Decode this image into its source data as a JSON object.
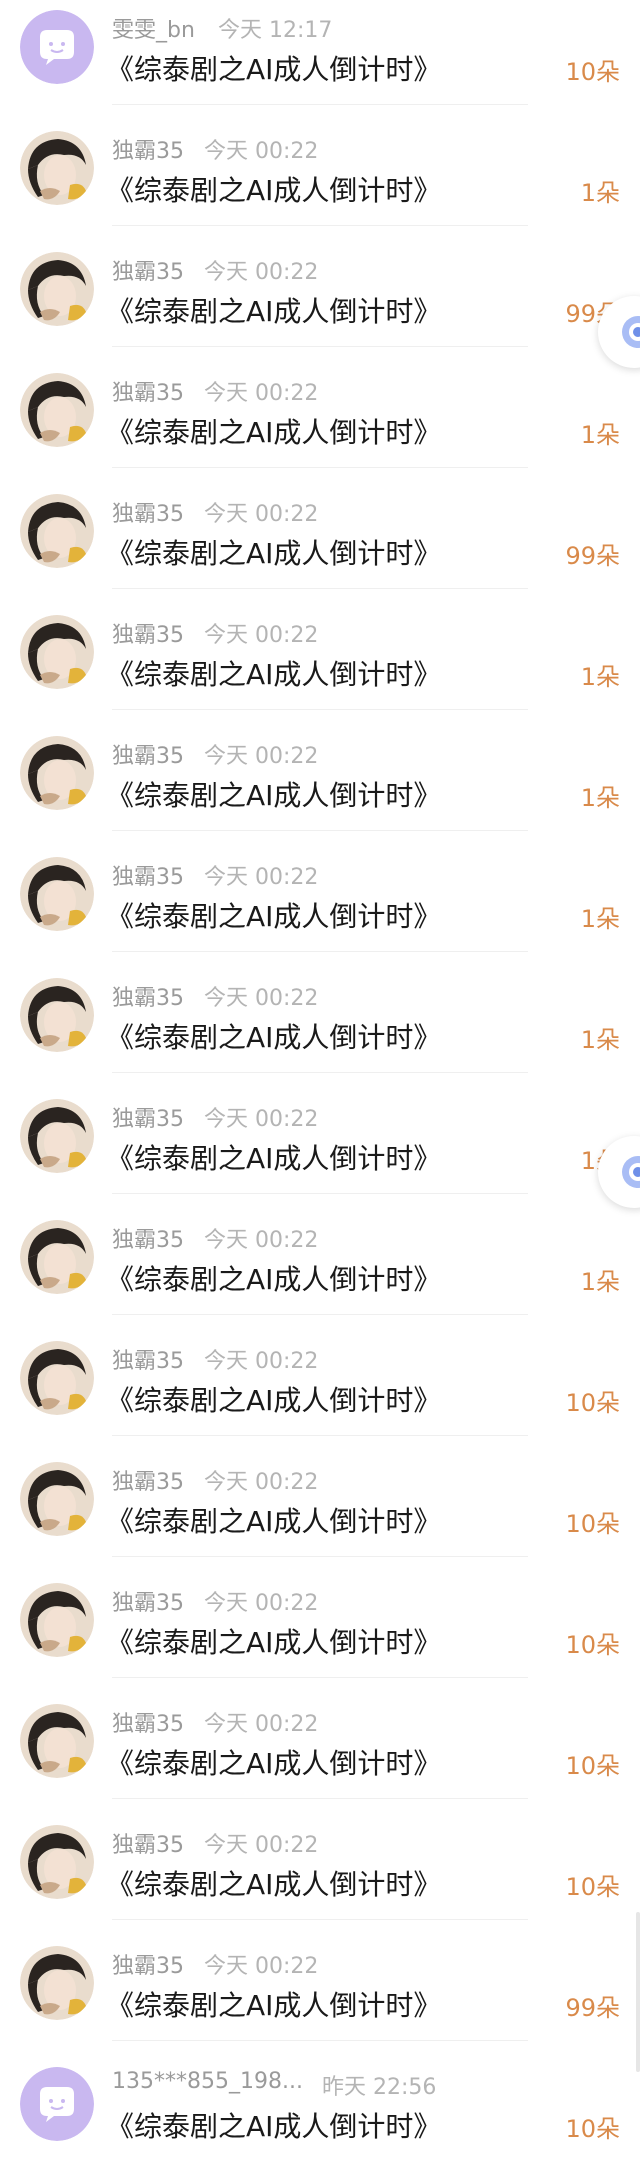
{
  "colors": {
    "gift_text": "#d98a4a",
    "title_text": "#1a1a1a",
    "name_text": "#9a9a9a",
    "time_text": "#b4b4b4",
    "lavender_avatar": "#c9b8f0"
  },
  "rows": [
    {
      "avatar": "speech-bubble-icon",
      "name": "雯雯_bn",
      "time": "今天 12:17",
      "title": "《综泰剧之AI成人倒计时》",
      "gift": "10朵"
    },
    {
      "avatar": "user-photo",
      "name": "独霸35",
      "time": "今天 00:22",
      "title": "《综泰剧之AI成人倒计时》",
      "gift": "1朵"
    },
    {
      "avatar": "user-photo",
      "name": "独霸35",
      "time": "今天 00:22",
      "title": "《综泰剧之AI成人倒计时》",
      "gift": "99朵"
    },
    {
      "avatar": "user-photo",
      "name": "独霸35",
      "time": "今天 00:22",
      "title": "《综泰剧之AI成人倒计时》",
      "gift": "1朵"
    },
    {
      "avatar": "user-photo",
      "name": "独霸35",
      "time": "今天 00:22",
      "title": "《综泰剧之AI成人倒计时》",
      "gift": "99朵"
    },
    {
      "avatar": "user-photo",
      "name": "独霸35",
      "time": "今天 00:22",
      "title": "《综泰剧之AI成人倒计时》",
      "gift": "1朵"
    },
    {
      "avatar": "user-photo",
      "name": "独霸35",
      "time": "今天 00:22",
      "title": "《综泰剧之AI成人倒计时》",
      "gift": "1朵"
    },
    {
      "avatar": "user-photo",
      "name": "独霸35",
      "time": "今天 00:22",
      "title": "《综泰剧之AI成人倒计时》",
      "gift": "1朵"
    },
    {
      "avatar": "user-photo",
      "name": "独霸35",
      "time": "今天 00:22",
      "title": "《综泰剧之AI成人倒计时》",
      "gift": "1朵"
    },
    {
      "avatar": "user-photo",
      "name": "独霸35",
      "time": "今天 00:22",
      "title": "《综泰剧之AI成人倒计时》",
      "gift": "1朵"
    },
    {
      "avatar": "user-photo",
      "name": "独霸35",
      "time": "今天 00:22",
      "title": "《综泰剧之AI成人倒计时》",
      "gift": "1朵"
    },
    {
      "avatar": "user-photo",
      "name": "独霸35",
      "time": "今天 00:22",
      "title": "《综泰剧之AI成人倒计时》",
      "gift": "10朵"
    },
    {
      "avatar": "user-photo",
      "name": "独霸35",
      "time": "今天 00:22",
      "title": "《综泰剧之AI成人倒计时》",
      "gift": "10朵"
    },
    {
      "avatar": "user-photo",
      "name": "独霸35",
      "time": "今天 00:22",
      "title": "《综泰剧之AI成人倒计时》",
      "gift": "10朵"
    },
    {
      "avatar": "user-photo",
      "name": "独霸35",
      "time": "今天 00:22",
      "title": "《综泰剧之AI成人倒计时》",
      "gift": "10朵"
    },
    {
      "avatar": "user-photo",
      "name": "独霸35",
      "time": "今天 00:22",
      "title": "《综泰剧之AI成人倒计时》",
      "gift": "10朵"
    },
    {
      "avatar": "user-photo",
      "name": "独霸35",
      "time": "今天 00:22",
      "title": "《综泰剧之AI成人倒计时》",
      "gift": "99朵"
    },
    {
      "avatar": "speech-bubble-icon",
      "name": "135***855_198...",
      "time": "昨天 22:56",
      "title": "《综泰剧之AI成人倒计时》",
      "gift": "10朵"
    }
  ]
}
